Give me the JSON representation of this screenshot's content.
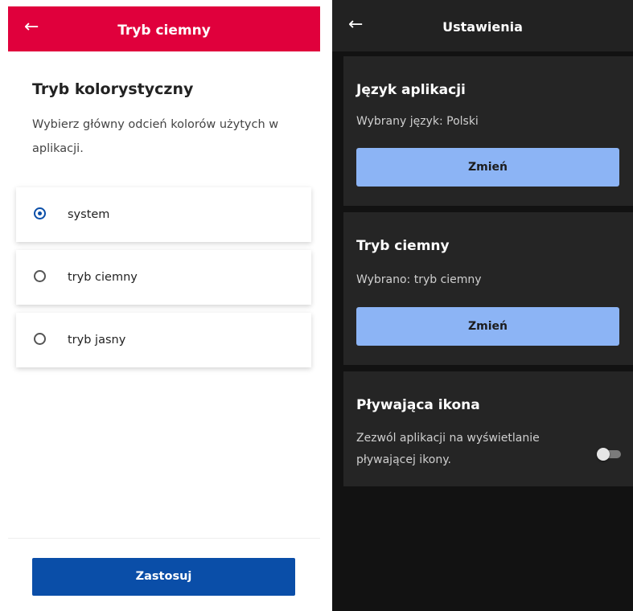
{
  "left_panel": {
    "header": {
      "title": "Tryb ciemny",
      "back_icon": "←"
    },
    "section_title": "Tryb kolorystyczny",
    "section_desc": "Wybierz główny odcień kolorów użytych w aplikacji.",
    "options": [
      {
        "label": "system",
        "selected": true
      },
      {
        "label": "tryb ciemny",
        "selected": false
      },
      {
        "label": "tryb jasny",
        "selected": false
      }
    ],
    "apply_label": "Zastosuj",
    "colors": {
      "header": "#e0003c",
      "accent": "#0a4ea8"
    }
  },
  "right_panel": {
    "header": {
      "title": "Ustawienia",
      "back_icon": "←"
    },
    "language_card": {
      "title": "Język aplikacji",
      "selected_text": "Wybrany język: Polski",
      "button_label": "Zmień"
    },
    "dark_mode_card": {
      "title": "Tryb ciemny",
      "selected_text": "Wybrano:  tryb ciemny",
      "button_label": "Zmień"
    },
    "floating_icon_card": {
      "title": "Pływająca ikona",
      "desc_line1": "Zezwól aplikacji na wyświetlanie",
      "desc_line2": "pływającej ikony.",
      "toggle_on": false
    },
    "colors": {
      "button": "#8cb4f5",
      "card": "#252525",
      "background": "#121212"
    }
  }
}
